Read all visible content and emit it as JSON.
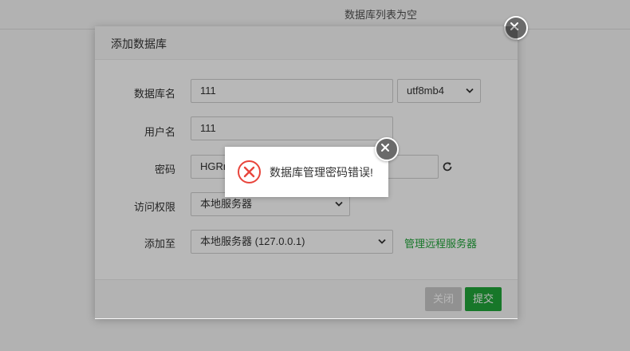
{
  "background": {
    "empty_text": "数据库列表为空"
  },
  "modal": {
    "title": "添加数据库",
    "fields": {
      "db_name_label": "数据库名",
      "db_name_value": "111",
      "charset_value": "utf8mb4",
      "username_label": "用户名",
      "username_value": "111",
      "password_label": "密码",
      "password_value": "HGRm",
      "access_label": "访问权限",
      "access_value": "本地服务器",
      "add_to_label": "添加至",
      "add_to_value": "本地服务器 (127.0.0.1)",
      "manage_remote_link": "管理远程服务器"
    },
    "buttons": {
      "close_label": "关闭",
      "submit_label": "提交"
    }
  },
  "alert": {
    "message": "数据库管理密码错误!"
  },
  "colors": {
    "accent": "#20a53a",
    "error": "#e8453c",
    "close_circle": "#6a6a6a"
  },
  "icons": [
    "close-icon",
    "refresh-icon",
    "chevron-down-icon",
    "error-icon"
  ]
}
